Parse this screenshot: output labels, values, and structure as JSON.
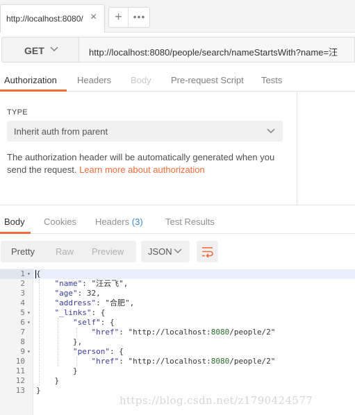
{
  "tabs": {
    "active_title": "http://localhost:8080/",
    "close_glyph": "×",
    "new_tab_glyph": "+",
    "more_glyph": "•••"
  },
  "request": {
    "method": "GET",
    "url": "http://localhost:8080/people/search/nameStartsWith?name=汪"
  },
  "request_tabs": [
    {
      "label": "Authorization",
      "state": "active"
    },
    {
      "label": "Headers",
      "state": "normal"
    },
    {
      "label": "Body",
      "state": "disabled"
    },
    {
      "label": "Pre-request Script",
      "state": "normal"
    },
    {
      "label": "Tests",
      "state": "normal"
    }
  ],
  "auth": {
    "type_label": "TYPE",
    "type_value": "Inherit auth from parent",
    "desc_line1": "The authorization header will be automatically generated when you",
    "desc_line2_prefix": "send the request. ",
    "desc_link": "Learn more about authorization"
  },
  "response_tabs": [
    {
      "label": "Body",
      "state": "active"
    },
    {
      "label": "Cookies",
      "state": "normal"
    },
    {
      "label": "Headers",
      "count": "(3)",
      "state": "normal"
    },
    {
      "label": "Test Results",
      "state": "normal"
    }
  ],
  "response_toolbar": {
    "views": [
      "Pretty",
      "Raw",
      "Preview"
    ],
    "active_view": "Pretty",
    "format": "JSON",
    "wrap_icon": "wrap-lines-icon"
  },
  "code_lines": [
    {
      "n": "1",
      "fold": "▾",
      "text": "{"
    },
    {
      "n": "2",
      "fold": "",
      "text": "    \"name\": \"汪云飞\","
    },
    {
      "n": "3",
      "fold": "",
      "text": "    \"age\": 32,"
    },
    {
      "n": "4",
      "fold": "",
      "text": "    \"address\": \"合肥\","
    },
    {
      "n": "5",
      "fold": "▾",
      "text": "    \"_links\": {"
    },
    {
      "n": "6",
      "fold": "▾",
      "text": "        \"self\": {"
    },
    {
      "n": "7",
      "fold": "",
      "text": "            \"href\": \"http://localhost:8080/people/2\""
    },
    {
      "n": "8",
      "fold": "",
      "text": "        },"
    },
    {
      "n": "9",
      "fold": "▾",
      "text": "        \"person\": {"
    },
    {
      "n": "10",
      "fold": "",
      "text": "            \"href\": \"http://localhost:8080/people/2\""
    },
    {
      "n": "11",
      "fold": "",
      "text": "        }"
    },
    {
      "n": "12",
      "fold": "",
      "text": "    }"
    },
    {
      "n": "13",
      "fold": "",
      "text": "}"
    }
  ],
  "watermark": "https://blog.csdn.net/z1790424577",
  "colors": {
    "accent": "#f26b3a",
    "count_blue": "#3b8bd0",
    "json_string": "#2222cc",
    "json_key": "#3a3a9a"
  }
}
